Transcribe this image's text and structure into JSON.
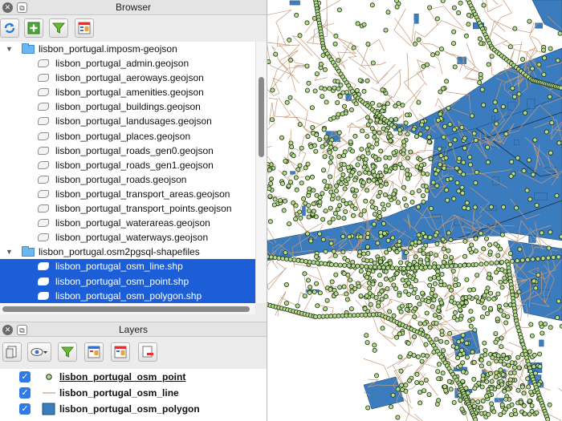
{
  "browser": {
    "title": "Browser",
    "tree": [
      {
        "kind": "folder",
        "label": "lisbon_portugal.imposm-geojson",
        "expanded": true,
        "selected": false
      },
      {
        "kind": "file",
        "label": "lisbon_portugal_admin.geojson",
        "selected": false
      },
      {
        "kind": "file",
        "label": "lisbon_portugal_aeroways.geojson",
        "selected": false
      },
      {
        "kind": "file",
        "label": "lisbon_portugal_amenities.geojson",
        "selected": false
      },
      {
        "kind": "file",
        "label": "lisbon_portugal_buildings.geojson",
        "selected": false
      },
      {
        "kind": "file",
        "label": "lisbon_portugal_landusages.geojson",
        "selected": false
      },
      {
        "kind": "file",
        "label": "lisbon_portugal_places.geojson",
        "selected": false
      },
      {
        "kind": "file",
        "label": "lisbon_portugal_roads_gen0.geojson",
        "selected": false
      },
      {
        "kind": "file",
        "label": "lisbon_portugal_roads_gen1.geojson",
        "selected": false
      },
      {
        "kind": "file",
        "label": "lisbon_portugal_roads.geojson",
        "selected": false
      },
      {
        "kind": "file",
        "label": "lisbon_portugal_transport_areas.geojson",
        "selected": false
      },
      {
        "kind": "file",
        "label": "lisbon_portugal_transport_points.geojson",
        "selected": false
      },
      {
        "kind": "file",
        "label": "lisbon_portugal_waterareas.geojson",
        "selected": false
      },
      {
        "kind": "file",
        "label": "lisbon_portugal_waterways.geojson",
        "selected": false
      },
      {
        "kind": "folder",
        "label": "lisbon_portugal.osm2pgsql-shapefiles",
        "expanded": true,
        "selected": false
      },
      {
        "kind": "file",
        "label": "lisbon_portugal_osm_line.shp",
        "selected": true
      },
      {
        "kind": "file",
        "label": "lisbon_portugal_osm_point.shp",
        "selected": true
      },
      {
        "kind": "file",
        "label": "lisbon_portugal_osm_polygon.shp",
        "selected": true
      }
    ],
    "toolbar_icons": [
      "refresh-icon",
      "add-layer-icon",
      "filter-icon",
      "properties-icon"
    ]
  },
  "layers": {
    "title": "Layers",
    "toolbar_icons": [
      "open-layer-styling-icon",
      "visibility-eye-icon",
      "filter-icon",
      "expand-all-icon",
      "collapse-all-icon",
      "remove-layer-icon"
    ],
    "items": [
      {
        "name": "lisbon_portugal_osm_point",
        "checked": true,
        "symbol": "point",
        "active": true
      },
      {
        "name": "lisbon_portugal_osm_line",
        "checked": true,
        "symbol": "line",
        "active": false
      },
      {
        "name": "lisbon_portugal_osm_polygon",
        "checked": true,
        "symbol": "polygon",
        "active": false
      }
    ]
  },
  "colors": {
    "selection": "#1c5ed8",
    "point_fill": "#b5dc8d",
    "line": "#c49a7a",
    "polygon_fill": "#3a7cbd",
    "checkbox": "#2f7ae5"
  }
}
